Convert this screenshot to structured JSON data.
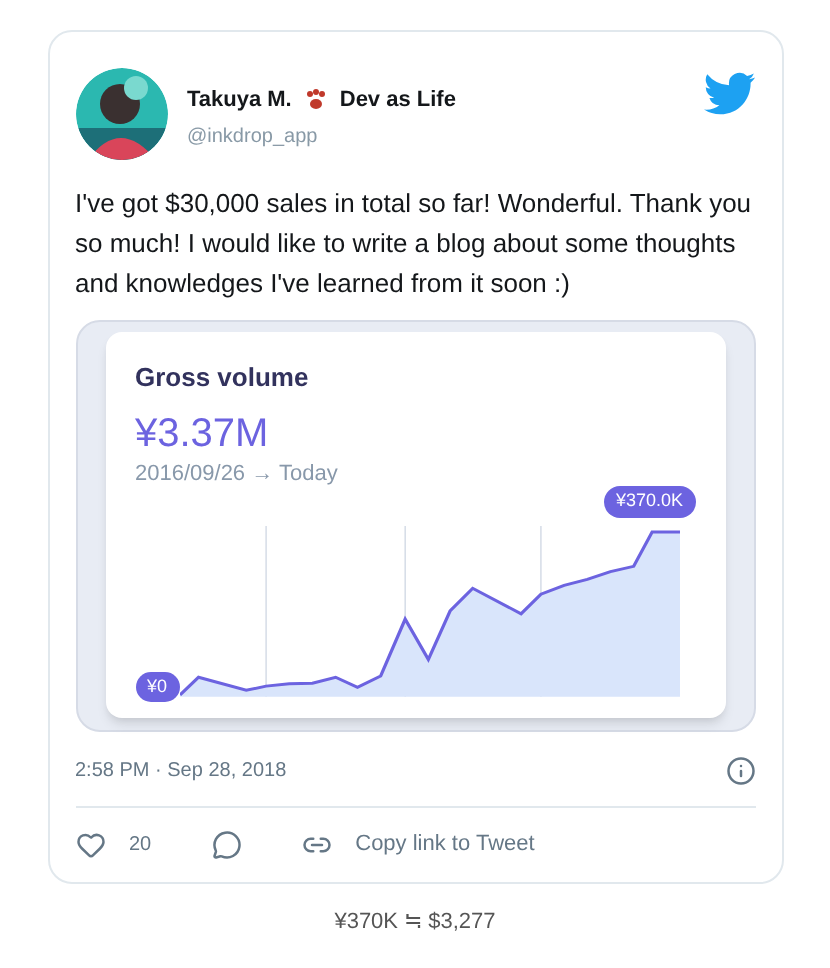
{
  "tweet": {
    "author_name": "Takuya M.",
    "author_tagline": "Dev as Life",
    "handle": "@inkdrop_app",
    "text": "I've got $30,000 sales in total so far! Wonderful. Thank you so much! I would like to write a blog about some thoughts and knowledges I've learned from it soon :)",
    "media": {
      "title": "Gross volume",
      "total": "¥3.37M",
      "range": "2016/09/26 → Today",
      "start_label": "¥0",
      "end_label": "¥370.0K"
    },
    "timestamp": "2:58 PM · Sep 28, 2018",
    "likes": "20",
    "copy_link": "Copy link to Tweet"
  },
  "caption": "¥370K ≒ $3,277"
}
